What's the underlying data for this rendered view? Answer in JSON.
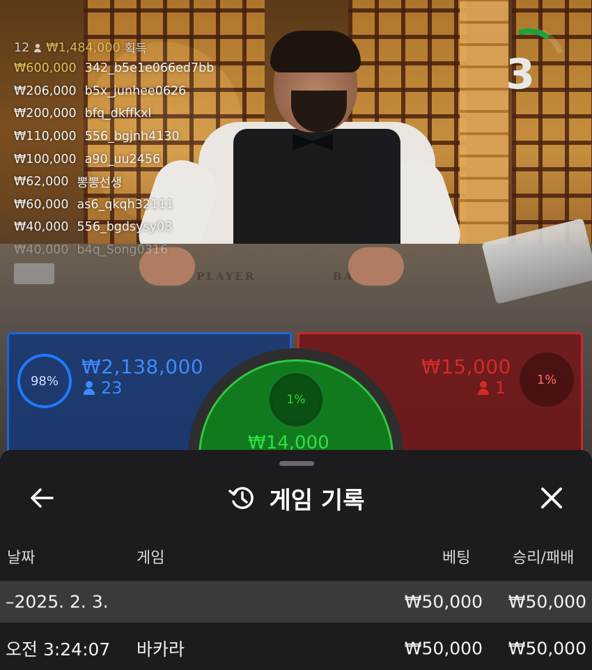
{
  "leaderboard": {
    "count": "12",
    "total": "₩1,484,000",
    "suffix": "획득",
    "rows": [
      {
        "amount": "₩600,000",
        "user": "342_b5e1e066ed7bb"
      },
      {
        "amount": "₩206,000",
        "user": "b5x_junhee0626"
      },
      {
        "amount": "₩200,000",
        "user": "bfq_dkffkxl"
      },
      {
        "amount": "₩110,000",
        "user": "556_bgjnh4130"
      },
      {
        "amount": "₩100,000",
        "user": "a90_uu2456"
      },
      {
        "amount": "₩62,000",
        "user": "뽕뽕선생"
      },
      {
        "amount": "₩60,000",
        "user": "as6_qkqh32111"
      },
      {
        "amount": "₩40,000",
        "user": "556_bgdsysy03"
      },
      {
        "amount": "₩40,000",
        "user": "b4q_Song0316"
      }
    ]
  },
  "timer": {
    "seconds": "3",
    "remaining_fraction": 0.2
  },
  "table_text": {
    "player": "PLAYER",
    "banker": "BANKER"
  },
  "bets": {
    "player": {
      "percent": "98%",
      "amount": "₩2,138,000",
      "players": "23",
      "color": "#1e64d8"
    },
    "banker": {
      "percent": "1%",
      "amount": "₩15,000",
      "players": "1",
      "color": "#c52a2a"
    },
    "tie": {
      "percent": "1%",
      "amount": "₩14,000",
      "color": "#2fc83c"
    }
  },
  "history": {
    "title": "게임 기록",
    "icons": {
      "back": "arrow-left-icon",
      "title": "history-icon",
      "close": "close-icon"
    },
    "columns": {
      "date": "날짜",
      "game": "게임",
      "bet": "베팅",
      "result": "승리/패배"
    },
    "date_group": {
      "date": "–2025. 2. 3.",
      "bet": "₩50,000",
      "result": "₩50,000"
    },
    "rows": [
      {
        "time": "오전 3:24:07",
        "game": "바카라",
        "bet": "₩50,000",
        "result": "₩50,000"
      }
    ]
  }
}
